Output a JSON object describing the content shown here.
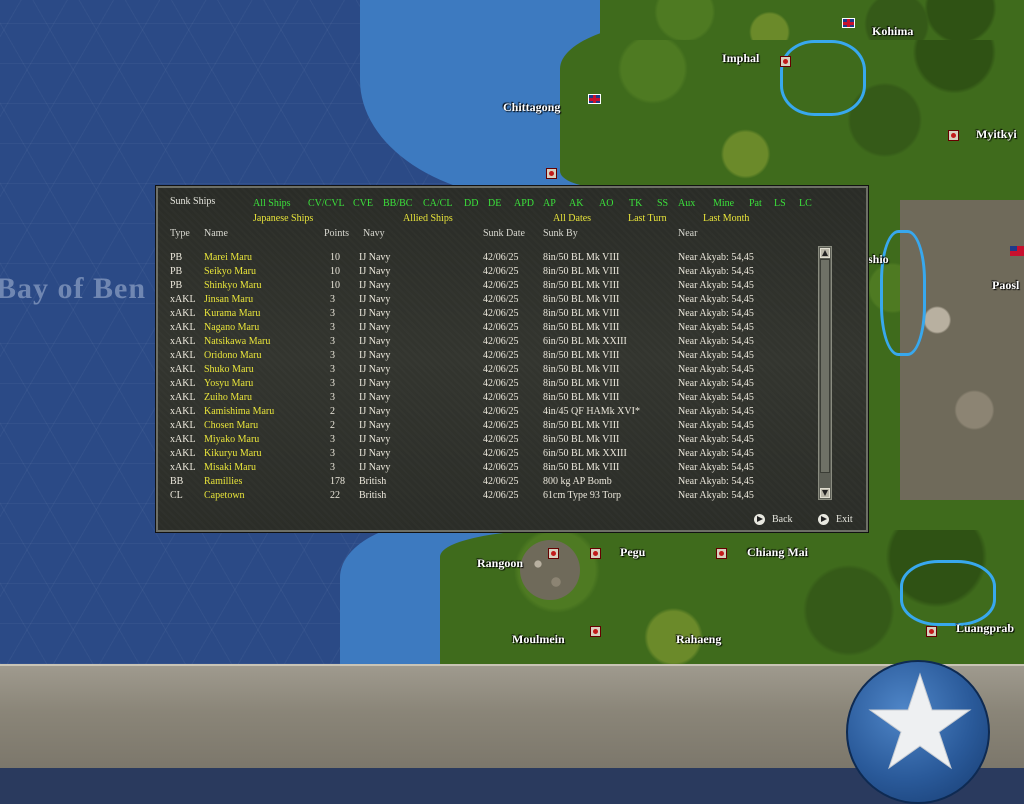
{
  "map": {
    "bay_label": "Bay of Ben",
    "places": [
      "Kohima",
      "Imphal",
      "Chittagong",
      "Myitkyi",
      "shio",
      "Paosl",
      "Rangoon",
      "Pegu",
      "Chiang Mai",
      "Moulmein",
      "Rahaeng",
      "Luangprab"
    ]
  },
  "dialog": {
    "title": "Sunk Ships",
    "type_filters": [
      "All Ships",
      "CV/CVL",
      "CVE",
      "BB/BC",
      "CA/CL",
      "DD",
      "DE",
      "APD",
      "AP",
      "AK",
      "AO",
      "TK",
      "SS",
      "Aux",
      "Mine",
      "Pat",
      "LS",
      "LC"
    ],
    "side_filters": [
      "Japanese Ships",
      "Allied Ships"
    ],
    "date_filters": [
      "All Dates",
      "Last Turn",
      "Last Month"
    ],
    "columns": [
      "Type",
      "Name",
      "Points",
      "Navy",
      "Sunk Date",
      "Sunk By",
      "Near"
    ],
    "rows": [
      {
        "type": "PB",
        "name": "Marei Maru",
        "points": "10",
        "navy": "IJ Navy",
        "date": "42/06/25",
        "by": "8in/50 BL Mk VIII",
        "near": "Near Akyab: 54,45"
      },
      {
        "type": "PB",
        "name": "Seikyo Maru",
        "points": "10",
        "navy": "IJ Navy",
        "date": "42/06/25",
        "by": "8in/50 BL Mk VIII",
        "near": "Near Akyab: 54,45"
      },
      {
        "type": "PB",
        "name": "Shinkyo Maru",
        "points": "10",
        "navy": "IJ Navy",
        "date": "42/06/25",
        "by": "8in/50 BL Mk VIII",
        "near": "Near Akyab: 54,45"
      },
      {
        "type": "xAKL",
        "name": "Jinsan Maru",
        "points": "3",
        "navy": "IJ Navy",
        "date": "42/06/25",
        "by": "8in/50 BL Mk VIII",
        "near": "Near Akyab: 54,45"
      },
      {
        "type": "xAKL",
        "name": "Kurama Maru",
        "points": "3",
        "navy": "IJ Navy",
        "date": "42/06/25",
        "by": "8in/50 BL Mk VIII",
        "near": "Near Akyab: 54,45"
      },
      {
        "type": "xAKL",
        "name": "Nagano Maru",
        "points": "3",
        "navy": "IJ Navy",
        "date": "42/06/25",
        "by": "8in/50 BL Mk VIII",
        "near": "Near Akyab: 54,45"
      },
      {
        "type": "xAKL",
        "name": "Natsikawa Maru",
        "points": "3",
        "navy": "IJ Navy",
        "date": "42/06/25",
        "by": "6in/50 BL Mk XXIII",
        "near": "Near Akyab: 54,45"
      },
      {
        "type": "xAKL",
        "name": "Oridono Maru",
        "points": "3",
        "navy": "IJ Navy",
        "date": "42/06/25",
        "by": "8in/50 BL Mk VIII",
        "near": "Near Akyab: 54,45"
      },
      {
        "type": "xAKL",
        "name": "Shuko Maru",
        "points": "3",
        "navy": "IJ Navy",
        "date": "42/06/25",
        "by": "8in/50 BL Mk VIII",
        "near": "Near Akyab: 54,45"
      },
      {
        "type": "xAKL",
        "name": "Yosyu Maru",
        "points": "3",
        "navy": "IJ Navy",
        "date": "42/06/25",
        "by": "8in/50 BL Mk VIII",
        "near": "Near Akyab: 54,45"
      },
      {
        "type": "xAKL",
        "name": "Zuiho Maru",
        "points": "3",
        "navy": "IJ Navy",
        "date": "42/06/25",
        "by": "8in/50 BL Mk VIII",
        "near": "Near Akyab: 54,45"
      },
      {
        "type": "xAKL",
        "name": "Kamishima Maru",
        "points": "2",
        "navy": "IJ Navy",
        "date": "42/06/25",
        "by": "4in/45 QF HAMk XVI*",
        "near": "Near Akyab: 54,45"
      },
      {
        "type": "xAKL",
        "name": "Chosen Maru",
        "points": "2",
        "navy": "IJ Navy",
        "date": "42/06/25",
        "by": "8in/50 BL Mk VIII",
        "near": "Near Akyab: 54,45"
      },
      {
        "type": "xAKL",
        "name": "Miyako Maru",
        "points": "3",
        "navy": "IJ Navy",
        "date": "42/06/25",
        "by": "8in/50 BL Mk VIII",
        "near": "Near Akyab: 54,45"
      },
      {
        "type": "xAKL",
        "name": "Kikuryu Maru",
        "points": "3",
        "navy": "IJ Navy",
        "date": "42/06/25",
        "by": "6in/50 BL Mk XXIII",
        "near": "Near Akyab: 54,45"
      },
      {
        "type": "xAKL",
        "name": "Misaki Maru",
        "points": "3",
        "navy": "IJ Navy",
        "date": "42/06/25",
        "by": "8in/50 BL Mk VIII",
        "near": "Near Akyab: 54,45"
      },
      {
        "type": "BB",
        "name": "Ramillies",
        "points": "178",
        "navy": "British",
        "date": "42/06/25",
        "by": "800 kg AP Bomb",
        "near": "Near Akyab: 54,45"
      },
      {
        "type": "CL",
        "name": "Capetown",
        "points": "22",
        "navy": "British",
        "date": "42/06/25",
        "by": "61cm Type 93 Torp",
        "near": "Near Akyab: 54,45"
      }
    ],
    "back_label": "Back",
    "exit_label": "Exit"
  },
  "colors": {
    "filter_green": "#3be03b",
    "name_yellow": "#e8e43a",
    "dialog_bg": "#2f312c"
  }
}
